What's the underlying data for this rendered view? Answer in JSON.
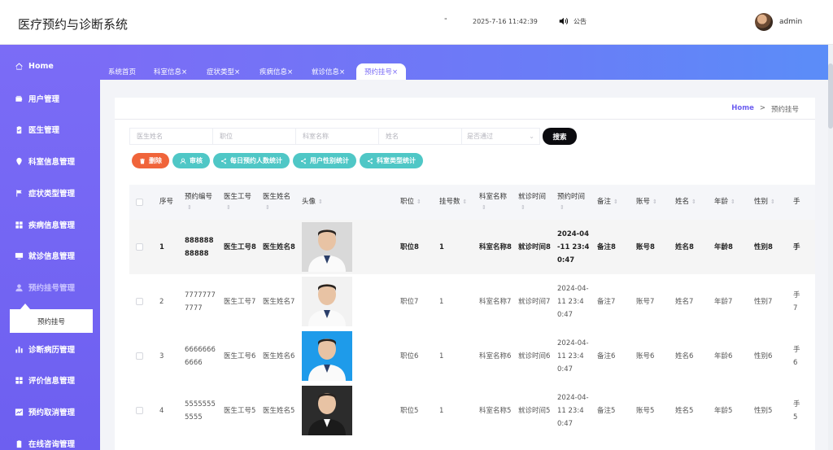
{
  "header": {
    "title": "医疗预约与诊断系统",
    "dot": "\"",
    "datetime": "2025-7-16 11:42:39",
    "notice": "公告",
    "user": "admin"
  },
  "sidebar": {
    "items": [
      {
        "label": "Home",
        "icon": "home-icon"
      },
      {
        "label": "用户管理",
        "icon": "wallet-icon"
      },
      {
        "label": "医生管理",
        "icon": "clipboard-icon"
      },
      {
        "label": "科室信息管理",
        "icon": "pin-icon"
      },
      {
        "label": "症状类型管理",
        "icon": "flag-icon"
      },
      {
        "label": "疾病信息管理",
        "icon": "grid-icon"
      },
      {
        "label": "就诊信息管理",
        "icon": "monitor-icon"
      },
      {
        "label": "预约挂号管理",
        "icon": "user-icon"
      },
      {
        "label": "诊断病历管理",
        "icon": "bar-chart-icon"
      },
      {
        "label": "评价信息管理",
        "icon": "grid-icon"
      },
      {
        "label": "预约取消管理",
        "icon": "trend-icon"
      },
      {
        "label": "在线咨询管理",
        "icon": "clipboard-icon"
      }
    ],
    "submenu_item": "预约挂号"
  },
  "tabs": [
    {
      "label": "系统首页"
    },
    {
      "label": "科室信息×"
    },
    {
      "label": "症状类型×"
    },
    {
      "label": "疾病信息×"
    },
    {
      "label": "就诊信息×"
    },
    {
      "label": "预约挂号×"
    }
  ],
  "breadcrumb": {
    "home": "Home",
    "sep": ">",
    "current": "预约挂号"
  },
  "search": {
    "doctor_name": "医生姓名",
    "title": "职位",
    "dept_name": "科室名称",
    "name": "姓名",
    "passed": "是否通过",
    "button": "搜索"
  },
  "actions": {
    "delete": "删除",
    "review": "审核",
    "daily_stats": "每日预约人数统计",
    "gender_stats": "用户性别统计",
    "dept_stats": "科室类型统计"
  },
  "table": {
    "columns": [
      "序号",
      "预约编号",
      "医生工号",
      "医生姓名",
      "头像",
      "职位",
      "挂号数",
      "科室名称",
      "就诊时间",
      "预约时间",
      "备注",
      "账号",
      "姓名",
      "年龄",
      "性别",
      "手"
    ],
    "rows": [
      {
        "index": "1",
        "booking_no": "88888888888",
        "doctor_no": "医生工号8",
        "doctor_name": "医生姓名8",
        "title": "职位8",
        "count": "1",
        "dept": "科室名称8",
        "visit_time": "就诊时间8",
        "booked_at": "2024-04-11 23:40:47",
        "note": "备注8",
        "account": "账号8",
        "name": "姓名8",
        "age": "年龄8",
        "gender": "性别8",
        "more": "手"
      },
      {
        "index": "2",
        "booking_no": "77777777777",
        "doctor_no": "医生工号7",
        "doctor_name": "医生姓名7",
        "title": "职位7",
        "count": "1",
        "dept": "科室名称7",
        "visit_time": "就诊时间7",
        "booked_at": "2024-04-11 23:40:47",
        "note": "备注7",
        "account": "账号7",
        "name": "姓名7",
        "age": "年龄7",
        "gender": "性别7",
        "more": "手7"
      },
      {
        "index": "3",
        "booking_no": "66666666666",
        "doctor_no": "医生工号6",
        "doctor_name": "医生姓名6",
        "title": "职位6",
        "count": "1",
        "dept": "科室名称6",
        "visit_time": "就诊时间6",
        "booked_at": "2024-04-11 23:40:47",
        "note": "备注6",
        "account": "账号6",
        "name": "姓名6",
        "age": "年龄6",
        "gender": "性别6",
        "more": "手6"
      },
      {
        "index": "4",
        "booking_no": "55555555555",
        "doctor_no": "医生工号5",
        "doctor_name": "医生姓名5",
        "title": "职位5",
        "count": "1",
        "dept": "科室名称5",
        "visit_time": "就诊时间5",
        "booked_at": "2024-04-11 23:40:47",
        "note": "备注5",
        "account": "账号5",
        "name": "姓名5",
        "age": "年龄5",
        "gender": "性别5",
        "more": "手5"
      }
    ]
  },
  "colors": {
    "sidebar": "#7b6cf6",
    "accent": "#6d5ff0",
    "delete": "#f0643a",
    "action": "#4fc7c6",
    "search_button": "#0b0b0f"
  }
}
